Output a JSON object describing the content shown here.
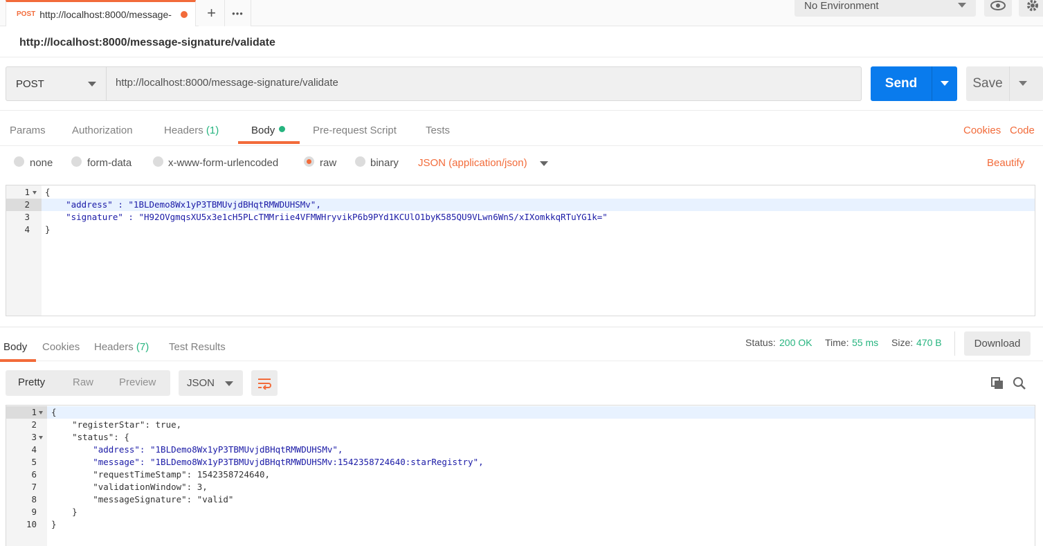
{
  "tab": {
    "method": "POST",
    "url": "http://localhost:8000/message-",
    "add_icon": "+",
    "more_icon": "•••"
  },
  "environment": {
    "selected": "No Environment"
  },
  "request": {
    "title": "http://localhost:8000/message-signature/validate",
    "method": "POST",
    "url": "http://localhost:8000/message-signature/validate",
    "send_label": "Send",
    "save_label": "Save"
  },
  "request_tabs": [
    {
      "label": "Params"
    },
    {
      "label": "Authorization"
    },
    {
      "label": "Headers ",
      "count": "(1)"
    },
    {
      "label": "Body"
    },
    {
      "label": "Pre-request Script"
    },
    {
      "label": "Tests"
    }
  ],
  "request_links": {
    "cookies": "Cookies",
    "code": "Code",
    "beautify": "Beautify"
  },
  "body_types": [
    {
      "label": "none",
      "selected": false
    },
    {
      "label": "form-data",
      "selected": false
    },
    {
      "label": "x-www-form-urlencoded",
      "selected": false
    },
    {
      "label": "raw",
      "selected": true
    },
    {
      "label": "binary",
      "selected": false
    }
  ],
  "content_type": "JSON (application/json)",
  "request_body": {
    "line_numbers": [
      "1",
      "2",
      "3",
      "4"
    ],
    "lines": [
      "{",
      "    \"address\" : \"1BLDemo8Wx1yP3TBMUvjdBHqtRMWDUHSMv\",",
      "    \"signature\" : \"H92OVgmqsXU5x3e1cH5PLcTMMriie4VFMWHryvikP6b9PYd1KCUlO1byK585QU9VLwn6WnS/xIXomkkqRTuYG1k=\"",
      "}"
    ]
  },
  "response_tabs": [
    {
      "label": "Body"
    },
    {
      "label": "Cookies"
    },
    {
      "label": "Headers ",
      "count": "(7)"
    },
    {
      "label": "Test Results"
    }
  ],
  "response_status": {
    "status_label": "Status:",
    "status_value": "200 OK",
    "time_label": "Time:",
    "time_value": "55 ms",
    "size_label": "Size:",
    "size_value": "470 B",
    "download_label": "Download"
  },
  "response_format": {
    "options": [
      "Pretty",
      "Raw",
      "Preview"
    ],
    "selected_type": "JSON"
  },
  "response_body": {
    "line_numbers": [
      "1",
      "2",
      "3",
      "4",
      "5",
      "6",
      "7",
      "8",
      "9",
      "10"
    ],
    "lines": [
      "{",
      "    \"registerStar\": true,",
      "    \"status\": {",
      "        \"address\": \"1BLDemo8Wx1yP3TBMUvjdBHqtRMWDUHSMv\",",
      "        \"message\": \"1BLDemo8Wx1yP3TBMUvjdBHqtRMWDUHSMv:1542358724640:starRegistry\",",
      "        \"requestTimeStamp\": 1542358724640,",
      "        \"validationWindow\": 3,",
      "        \"messageSignature\": \"valid\"",
      "    }",
      "}"
    ]
  },
  "colors": {
    "accent_orange": "#f26b3a",
    "send_blue": "#097bed",
    "status_green": "#26b47f"
  }
}
